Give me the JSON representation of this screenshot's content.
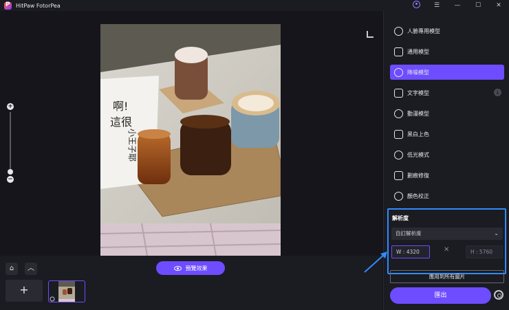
{
  "app": {
    "title": "HitPaw FotorPea"
  },
  "window_controls": [
    "account-icon",
    "menu-icon",
    "minimize-icon",
    "maximize-icon",
    "close-icon"
  ],
  "sidebar": {
    "models": [
      {
        "label": "人臉專用模型",
        "icon": "face-icon",
        "active": false
      },
      {
        "label": "通用模型",
        "icon": "image-icon",
        "active": false
      },
      {
        "label": "降噪模型",
        "icon": "denoise-icon",
        "active": true
      },
      {
        "label": "文字模型",
        "icon": "text-icon",
        "active": false,
        "download": true
      },
      {
        "label": "動漫模型",
        "icon": "anime-icon",
        "active": false
      },
      {
        "label": "黑白上色",
        "icon": "colorize-icon",
        "active": false
      },
      {
        "label": "低光模式",
        "icon": "lowlight-icon",
        "active": false
      },
      {
        "label": "劃痕修復",
        "icon": "scratch-icon",
        "active": false
      },
      {
        "label": "顏色校正",
        "icon": "color-correction-icon",
        "active": false
      }
    ],
    "resolution": {
      "title": "解析度",
      "selected": "自訂解析度",
      "width": "W : 4320",
      "height": "H : 5760"
    },
    "apply_all_label": "應用到所有圖片",
    "export_label": "匯出"
  },
  "bottom": {
    "preview_label": "預覽效果"
  },
  "photo_sign": {
    "line1": "啊!",
    "line2": "這很",
    "line3": "小王子耶"
  },
  "accent": "#6d4dff",
  "highlight": "#2f8cff"
}
